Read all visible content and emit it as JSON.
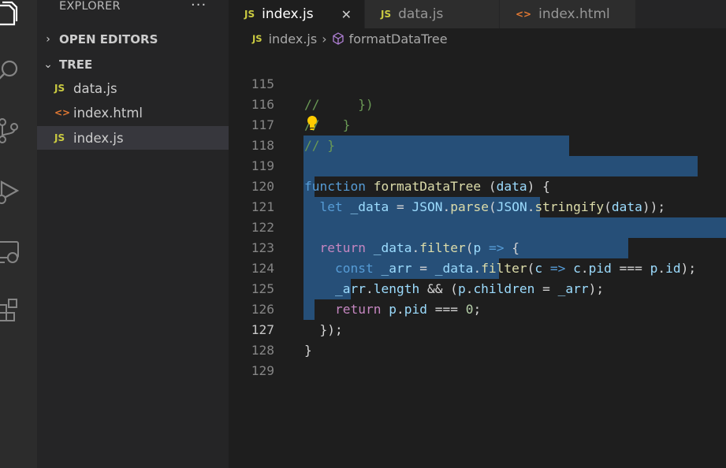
{
  "explorer": {
    "title": "EXPLORER",
    "more": "···",
    "open_editors": {
      "chevron": "›",
      "label": "OPEN EDITORS"
    },
    "tree": {
      "chevron": "⌄",
      "label": "TREE",
      "files": [
        {
          "icon": "JS",
          "name": "data.js"
        },
        {
          "icon": "<>",
          "name": "index.html"
        },
        {
          "icon": "JS",
          "name": "index.js",
          "active": true
        }
      ]
    }
  },
  "tabs": [
    {
      "icon": "JS",
      "label": "index.js",
      "active": true,
      "close": "✕"
    },
    {
      "icon": "JS",
      "label": "data.js"
    },
    {
      "icon": "<>",
      "label": "index.html"
    }
  ],
  "breadcrumb": {
    "file_icon": "JS",
    "file": "index.js",
    "sep": "›",
    "symbol": "formatDataTree"
  },
  "editor": {
    "current_line": "127",
    "line_numbers": [
      "115",
      "116",
      "117",
      "118",
      "119",
      "120",
      "121",
      "122",
      "123",
      "124",
      "125",
      "126",
      "127",
      "128",
      "129"
    ],
    "code": {
      "l115": {
        "comment": "//     })"
      },
      "l116": {
        "comment": "//   }"
      },
      "l117": {
        "comment": "// }"
      },
      "l119": {
        "kw": "function",
        "fn": "formatDataTree",
        "open": " (",
        "param": "data",
        "close": ") {"
      },
      "l120": {
        "kw": "let",
        "var": "_data",
        "eq": " = ",
        "cls": "JSON",
        "dot1": ".",
        "fn1": "parse",
        "p1": "(",
        "cls2": "JSON",
        "dot2": ".",
        "fn2": "stringify",
        "p2": "(",
        "arg": "data",
        "end": "));"
      },
      "l122": {
        "kw": "return",
        "var": "_data",
        "dot": ".",
        "fn": "filter",
        "p": "(",
        "param": "p",
        "arrow": "=>",
        "brace": " {"
      },
      "l123": {
        "kw": "const",
        "var": "_arr",
        "eq": " = ",
        "obj": "_data",
        "dot": ".",
        "fn": "filter",
        "p": "(",
        "param": "c",
        "arrow": "=>",
        "a": "c",
        "dotb": ".",
        "b": "pid",
        "eqq": " === ",
        "c": "p",
        "dotc": ".",
        "d": "id",
        "end": ");"
      },
      "l124": {
        "a": "_arr",
        "dot": ".",
        "b": "length",
        "and": " && (",
        "c": "p",
        "dotc": ".",
        "d": "children",
        "eq": " = ",
        "e": "_arr",
        "end": ");"
      },
      "l125": {
        "kw": "return",
        "a": "p",
        "dot": ".",
        "b": "pid",
        "eqq": " === ",
        "num": "0",
        "end": ";"
      },
      "l126": {
        "text": "});"
      },
      "l127": {
        "text": "}"
      }
    }
  },
  "colors": {
    "selection": "#264f78",
    "keyword": "#569cd6",
    "function": "#dcdcaa",
    "variable": "#9cdcfe",
    "comment": "#6a9955",
    "js_icon": "#cbcb41",
    "html_icon": "#e37933"
  },
  "icons": [
    "files-icon",
    "search-icon",
    "source-control-icon",
    "run-debug-icon",
    "remote-explorer-icon",
    "extensions-icon",
    "lightbulb-icon",
    "text-cursor-icon",
    "symbol-method-icon"
  ]
}
